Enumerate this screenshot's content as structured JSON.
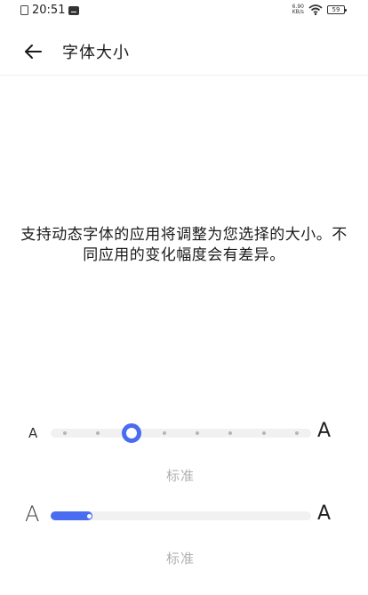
{
  "status_bar": {
    "time": "20:51",
    "net_speed_value": "6.90",
    "net_speed_unit": "KB/s",
    "battery": "59"
  },
  "header": {
    "title": "字体大小",
    "back_icon": "arrow-left-icon"
  },
  "description": "支持动态字体的应用将调整为您选择的大小。不同应用的变化幅度会有差异。",
  "font_size_slider": {
    "min_label": "A",
    "max_label": "A",
    "steps": 8,
    "selected_index": 2,
    "caption": "标准",
    "accent_color": "#4a6cf0"
  },
  "display_scale_slider": {
    "min_label": "A",
    "max_label": "A",
    "value_fraction": 0.16,
    "caption": "标准",
    "accent_color": "#4a6cf0"
  }
}
